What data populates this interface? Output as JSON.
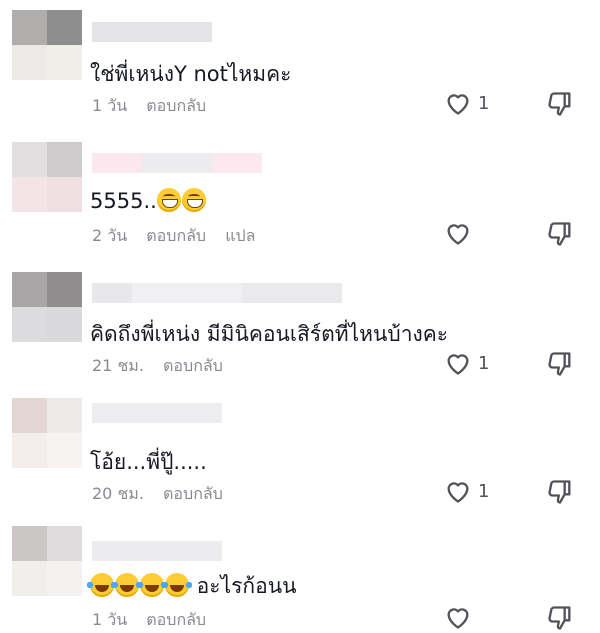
{
  "comments": [
    {
      "text": "ใช่พี่เหน่งY notไหมคะ",
      "time": "1 วัน",
      "reply": "ตอบกลับ",
      "translate": "",
      "likes": "1",
      "emoji": []
    },
    {
      "text": "5555..",
      "time": "2 วัน",
      "reply": "ตอบกลับ",
      "translate": "แปล",
      "likes": "",
      "emoji": [
        "grinning-face",
        "grinning-face"
      ]
    },
    {
      "text": "คิดถึงพี่เหน่ง มีมินิคอนเสิร์ตที่ไหนบ้างคะ",
      "time": "21 ชม.",
      "reply": "ตอบกลับ",
      "translate": "",
      "likes": "1",
      "emoji": []
    },
    {
      "text": "โอ้ย...พี่ปู๊.....",
      "time": "20 ชม.",
      "reply": "ตอบกลับ",
      "translate": "",
      "likes": "1",
      "emoji": []
    },
    {
      "text": " อะไรก้อนน",
      "time": "1 วัน",
      "reply": "ตอบกลับ",
      "translate": "",
      "likes": "",
      "emoji": [
        "face-with-tears-of-joy",
        "face-with-tears-of-joy",
        "face-with-tears-of-joy",
        "face-with-tears-of-joy"
      ]
    }
  ],
  "icons": {
    "like": "heart-outline-icon",
    "dislike": "thumbs-down-outline-icon"
  },
  "colors": {
    "text": "#161823",
    "meta": "#8a8b91",
    "icon": "#52535a"
  }
}
